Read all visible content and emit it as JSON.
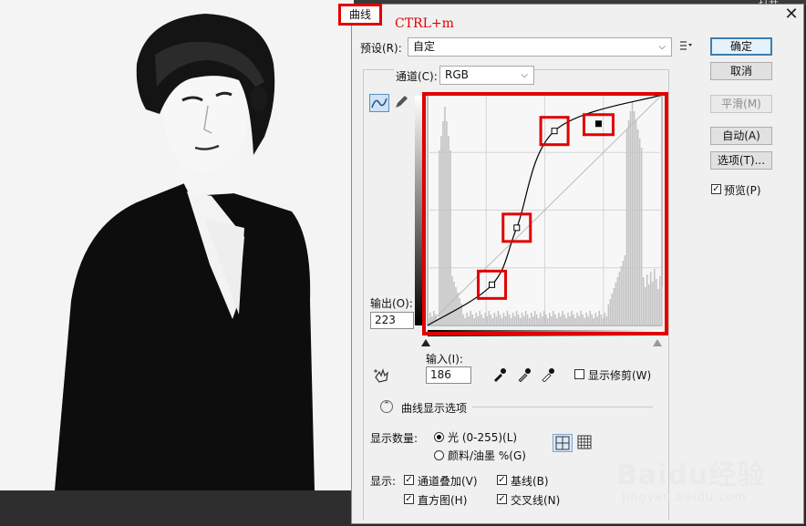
{
  "top_bar": {
    "label": "打开"
  },
  "dialog": {
    "title": "曲线",
    "shortcut_annotation": "CTRL+m",
    "preset": {
      "label": "预设(R):",
      "value": "自定"
    },
    "channel": {
      "label": "通道(C):",
      "value": "RGB"
    },
    "output": {
      "label": "输出(O):",
      "value": "223"
    },
    "input": {
      "label": "输入(I):",
      "value": "186"
    },
    "show_clipping": {
      "label": "显示修剪(W)",
      "checked": false
    },
    "curve_display_options": {
      "label": "曲线显示选项"
    },
    "show_amount": {
      "label": "显示数量:",
      "options": [
        {
          "label": "光 (0-255)(L)",
          "selected": true
        },
        {
          "label": "颜料/油墨 %(G)",
          "selected": false
        }
      ]
    },
    "show": {
      "label": "显示:",
      "options": [
        {
          "label": "通道叠加(V)",
          "checked": true
        },
        {
          "label": "基线(B)",
          "checked": true
        },
        {
          "label": "直方图(H)",
          "checked": true
        },
        {
          "label": "交叉线(N)",
          "checked": true
        }
      ]
    },
    "buttons": {
      "ok": "确定",
      "cancel": "取消",
      "smooth": "平滑(M)",
      "auto": "自动(A)",
      "options": "选项(T)..."
    },
    "preview": {
      "label": "预览(P)",
      "checked": true
    },
    "curve_points": [
      {
        "input": 0,
        "output": 0
      },
      {
        "input": 70,
        "output": 45
      },
      {
        "input": 97,
        "output": 108
      },
      {
        "input": 138,
        "output": 215
      },
      {
        "input": 255,
        "output": 255
      }
    ],
    "selected_point": {
      "input": 186,
      "output": 223
    }
  },
  "watermark": {
    "logo": "Baidu经验",
    "sub": "jingyan.baidu.com"
  },
  "colors": {
    "highlight_red": "#e00000",
    "accent_blue": "#3c7fb1"
  }
}
